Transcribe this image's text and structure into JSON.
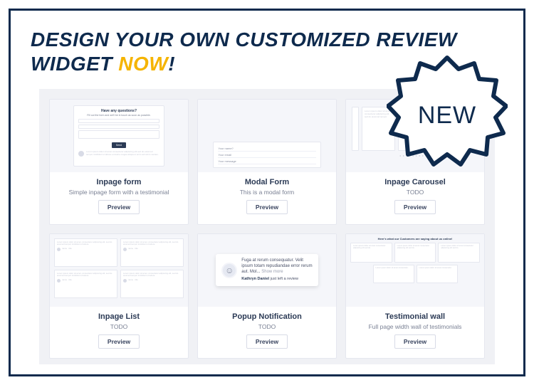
{
  "headline": {
    "pre": "DESIGN YOUR OWN CUSTOMIZED REVIEW WIDGET ",
    "now": "NOW",
    "bang": "!"
  },
  "badge": {
    "label": "NEW"
  },
  "placeholder": {
    "form_title": "Have any questions?",
    "form_subtitle": "Fill out the form and we'll be in touch as soon as possible.",
    "send": "Send",
    "modal_name": "Your name?",
    "modal_email": "Your email",
    "modal_msg": "Your message",
    "popup_text": "Fuga at rerum consequatur. Velit ipsum totam repudiandae error rerum aut. Mol... ",
    "popup_more": "Show more",
    "popup_name": "Kathryn Daniel",
    "popup_suffix": " just left a review",
    "wall_head": "Here's what our Customers are saying about us online!",
    "dots": "• • • • • • • • • •"
  },
  "cards": [
    {
      "title": "Inpage form",
      "desc": "Simple inpage form with a testimonial",
      "btn": "Preview"
    },
    {
      "title": "Modal Form",
      "desc": "This is a modal form",
      "btn": "Preview"
    },
    {
      "title": "Inpage Carousel",
      "desc": "TODO",
      "btn": "Preview"
    },
    {
      "title": "Inpage List",
      "desc": "TODO",
      "btn": "Preview"
    },
    {
      "title": "Popup Notification",
      "desc": "TODO",
      "btn": "Preview"
    },
    {
      "title": "Testimonial wall",
      "desc": "Full page width wall of testimonials",
      "btn": "Preview"
    }
  ]
}
